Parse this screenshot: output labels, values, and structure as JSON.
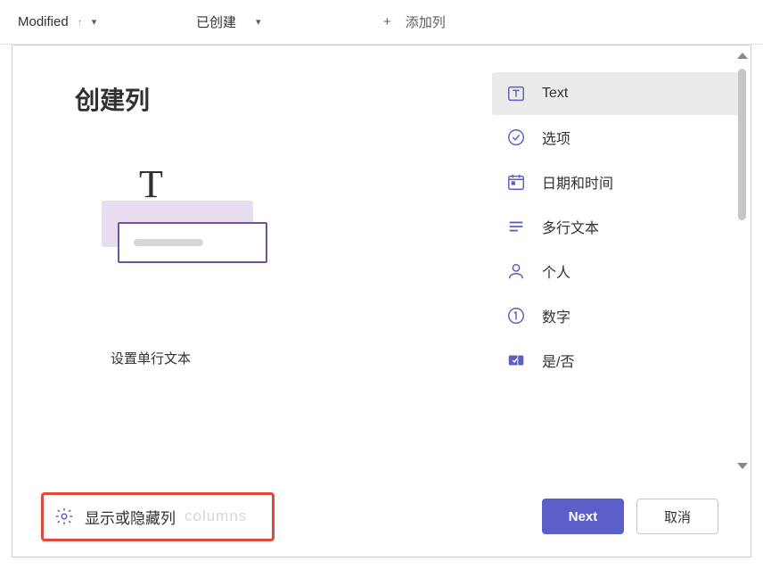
{
  "topbar": {
    "modified_label": "Modified",
    "created_label": "已创建",
    "add_column_label": "添加列"
  },
  "dialog": {
    "title": "创建列",
    "subtitle": "设置单行文本",
    "types": [
      {
        "key": "text",
        "label": "Text",
        "selected": true
      },
      {
        "key": "choice",
        "label": "选项",
        "selected": false
      },
      {
        "key": "datetime",
        "label": "日期和时间",
        "selected": false
      },
      {
        "key": "multiline",
        "label": "多行文本",
        "selected": false
      },
      {
        "key": "person",
        "label": "个人",
        "selected": false
      },
      {
        "key": "number",
        "label": "数字",
        "selected": false
      },
      {
        "key": "yesno",
        "label": "是/否",
        "selected": false
      }
    ],
    "show_hide_label": "显示或隐藏列",
    "next_label": "Next",
    "cancel_label": "取消"
  }
}
